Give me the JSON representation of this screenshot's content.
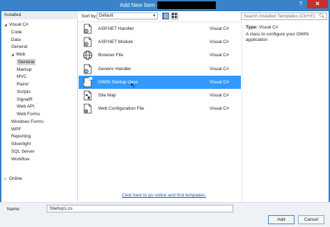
{
  "window": {
    "title": "Add New Item -",
    "help": "?",
    "close": "✕"
  },
  "left": {
    "header": "Installed",
    "tree": [
      {
        "label": "Visual C#",
        "indent": 1,
        "arrow": "◢",
        "selected": false
      },
      {
        "label": "Code",
        "indent": 2,
        "arrow": "",
        "selected": false
      },
      {
        "label": "Data",
        "indent": 2,
        "arrow": "",
        "selected": false
      },
      {
        "label": "General",
        "indent": 2,
        "arrow": "",
        "selected": false
      },
      {
        "label": "Web",
        "indent": 2,
        "arrow": "◢",
        "selected": false
      },
      {
        "label": "General",
        "indent": 3,
        "arrow": "",
        "selected": true
      },
      {
        "label": "Markup",
        "indent": 3,
        "arrow": "",
        "selected": false
      },
      {
        "label": "MVC",
        "indent": 3,
        "arrow": "",
        "selected": false
      },
      {
        "label": "Razor",
        "indent": 3,
        "arrow": "",
        "selected": false
      },
      {
        "label": "Scripts",
        "indent": 3,
        "arrow": "",
        "selected": false
      },
      {
        "label": "SignalR",
        "indent": 3,
        "arrow": "",
        "selected": false
      },
      {
        "label": "Web API",
        "indent": 3,
        "arrow": "",
        "selected": false
      },
      {
        "label": "Web Forms",
        "indent": 3,
        "arrow": "",
        "selected": false
      },
      {
        "label": "Windows Forms",
        "indent": 2,
        "arrow": "",
        "selected": false
      },
      {
        "label": "WPF",
        "indent": 2,
        "arrow": "",
        "selected": false
      },
      {
        "label": "Reporting",
        "indent": 2,
        "arrow": "",
        "selected": false
      },
      {
        "label": "Silverlight",
        "indent": 2,
        "arrow": "",
        "selected": false
      },
      {
        "label": "SQL Server",
        "indent": 2,
        "arrow": "",
        "selected": false
      },
      {
        "label": "Workflow",
        "indent": 2,
        "arrow": "",
        "selected": false
      }
    ],
    "online": "Online",
    "online_arrow": "▷"
  },
  "toolbar": {
    "sort_label": "Sort by:",
    "sort_value": "Default",
    "sort_arrow": "▼",
    "search_placeholder": "Search Installed Templates (Ctrl+E)",
    "search_icon": "search-icon"
  },
  "templates": [
    {
      "name": "ASP.NET Handler",
      "lang": "Visual C#",
      "icon": "handler-file-icon",
      "selected": false
    },
    {
      "name": "ASP.NET Module",
      "lang": "Visual C#",
      "icon": "module-file-icon",
      "selected": false
    },
    {
      "name": "Browser File",
      "lang": "Visual C#",
      "icon": "globe-icon",
      "selected": false
    },
    {
      "name": "Generic Handler",
      "lang": "Visual C#",
      "icon": "handler-file-icon",
      "selected": false
    },
    {
      "name": "OWIN Startup class",
      "lang": "Visual C#",
      "icon": "class-file-icon",
      "selected": true
    },
    {
      "name": "Site Map",
      "lang": "Visual C#",
      "icon": "sitemap-icon",
      "selected": false
    },
    {
      "name": "Web Configuration File",
      "lang": "Visual C#",
      "icon": "config-file-icon",
      "selected": false
    }
  ],
  "online_link": "Click here to go online and find templates.",
  "details": {
    "type_label": "Type:",
    "type_value": "Visual C#",
    "description": "A class to configure your OWIN application"
  },
  "bottom": {
    "name_label": "Name:",
    "name_value": "Startup1.cs",
    "add_label": "Add",
    "cancel_label": "Cancel"
  },
  "colors": {
    "titlebar": "#3a83c8",
    "selection": "#3399ff",
    "close": "#c7312b"
  }
}
